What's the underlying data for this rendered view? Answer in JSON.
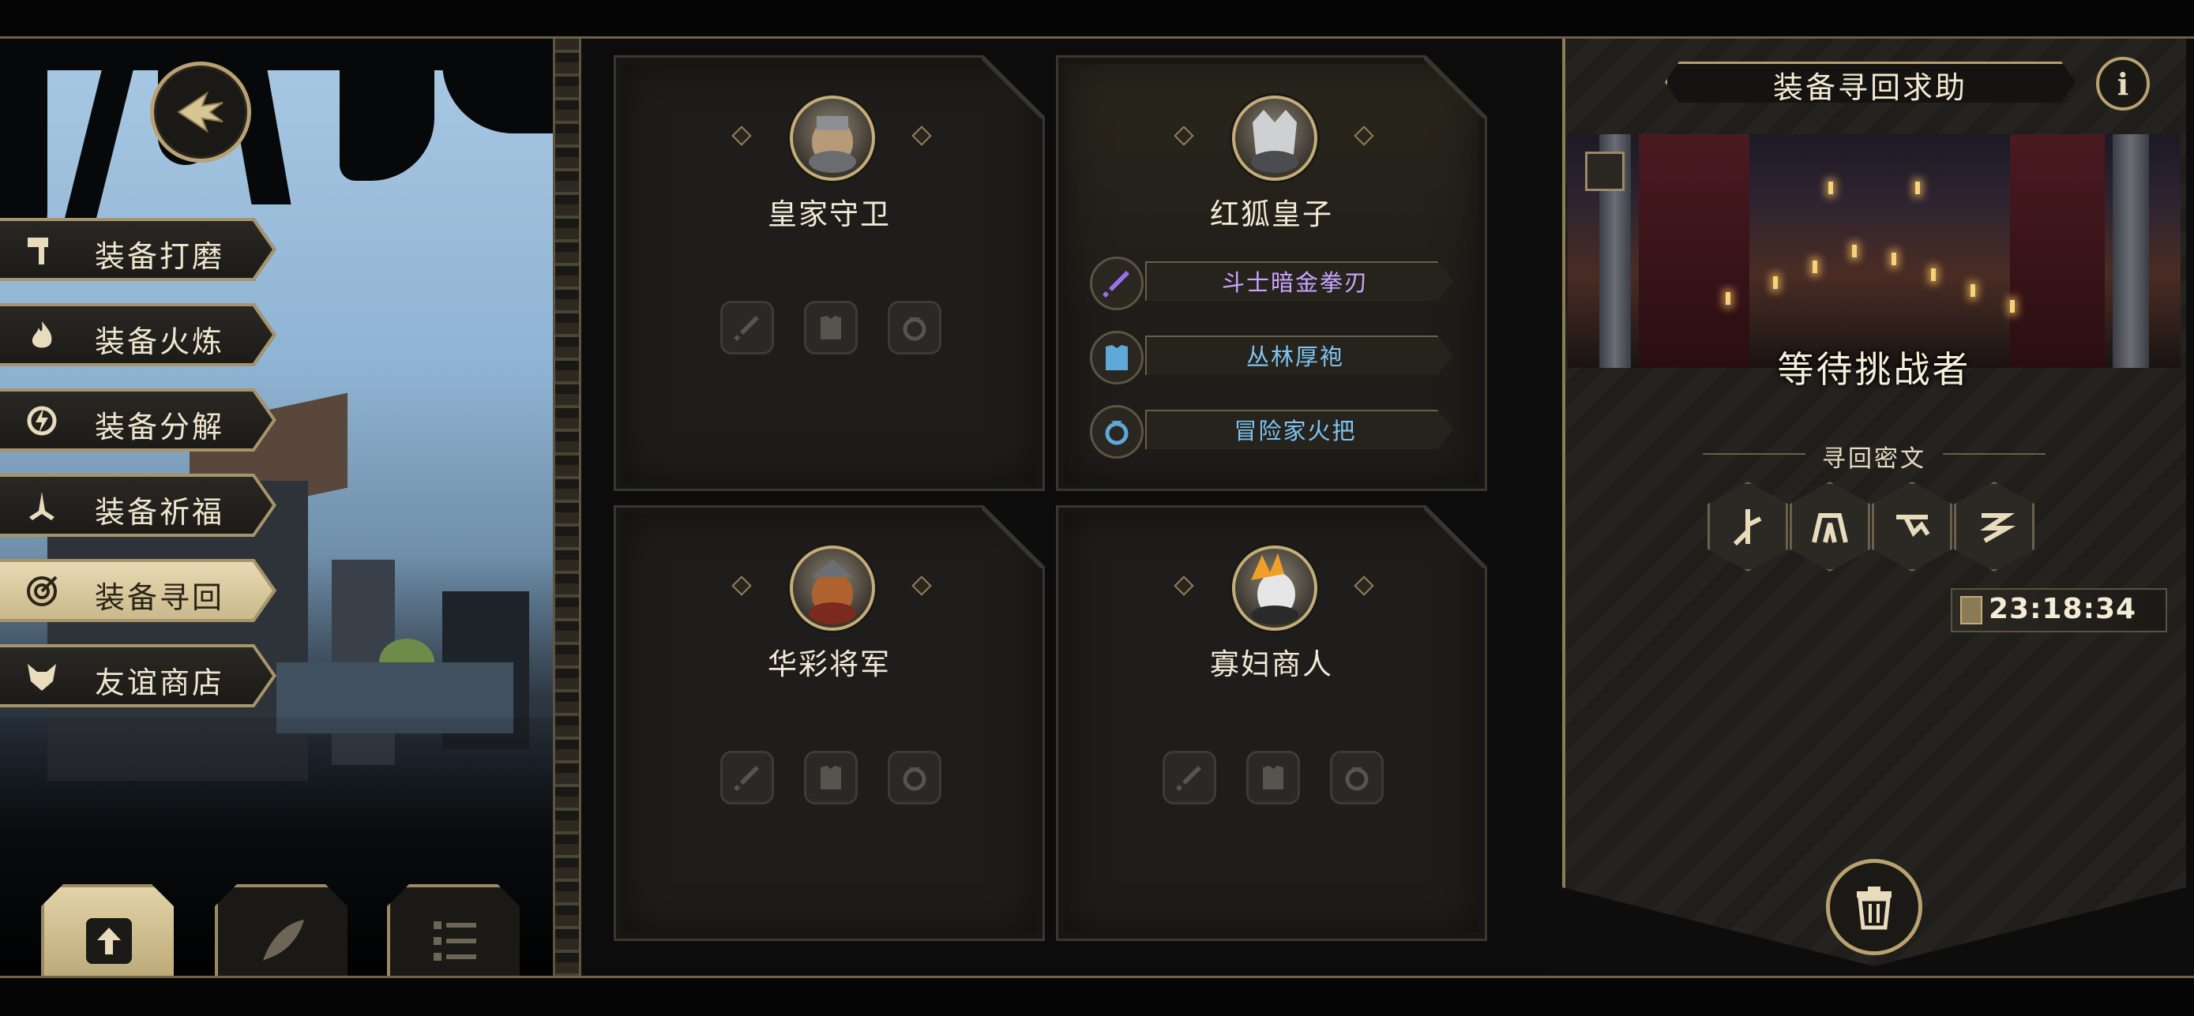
{
  "menu": {
    "items": [
      {
        "label": "装备打磨",
        "icon": "hammer-icon"
      },
      {
        "label": "装备火炼",
        "icon": "flame-icon"
      },
      {
        "label": "装备分解",
        "icon": "disassemble-icon"
      },
      {
        "label": "装备祈福",
        "icon": "prayer-hands-icon"
      },
      {
        "label": "装备寻回",
        "icon": "target-icon",
        "active": true
      },
      {
        "label": "友谊商店",
        "icon": "fox-icon"
      }
    ]
  },
  "bottom_tabs": [
    {
      "icon": "upload-doc-icon",
      "active": true
    },
    {
      "icon": "feather-icon"
    },
    {
      "icon": "list-icon"
    }
  ],
  "cards": [
    {
      "name": "皇家守卫",
      "equipment": []
    },
    {
      "name": "红狐皇子",
      "equipment": [
        {
          "label": "斗士暗金拳刃",
          "color": "#c9a6ff",
          "icon": "sword-icon"
        },
        {
          "label": "丛林厚袍",
          "color": "#7fc4f2",
          "icon": "armor-icon"
        },
        {
          "label": "冒险家火把",
          "color": "#7fc4f2",
          "icon": "ring-icon"
        }
      ]
    },
    {
      "name": "华彩将军",
      "equipment": []
    },
    {
      "name": "寡妇商人",
      "equipment": []
    }
  ],
  "panel": {
    "title": "装备寻回求助",
    "info_label": "i",
    "status": "等待挑战者",
    "subhead": "寻回密文",
    "timer": "23:18:34",
    "runes": [
      "rune-1-icon",
      "rune-2-icon",
      "rune-3-icon",
      "rune-4-icon"
    ]
  },
  "colors": {
    "accent_gold": "#b9a270",
    "purple_item": "#c9a6ff",
    "blue_item": "#7fc4f2"
  }
}
